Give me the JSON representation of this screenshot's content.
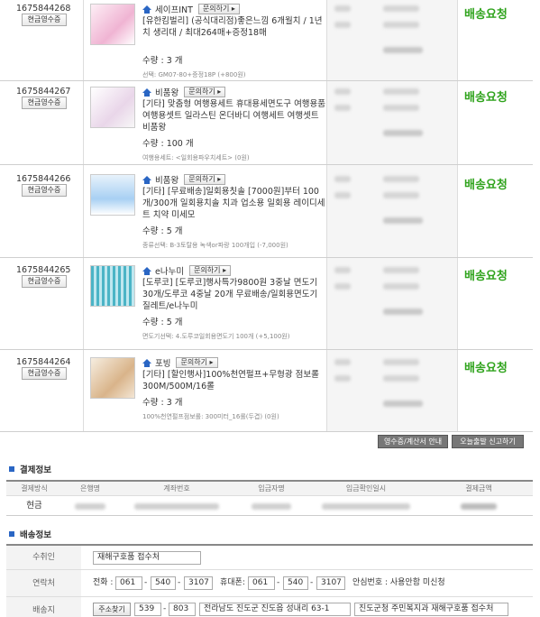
{
  "orders": [
    {
      "id": "1675844268",
      "receipt_label": "현금영수증",
      "seller": "세이프INT",
      "ask_label": "문의하기",
      "title": "[유한킴벌리] (공식대리점)좋은느낌 6개월치 / 1년치 생리대 / 최대264매+증정18매",
      "qty": "수량 : 3 개",
      "option": "선택: GM07-80+증정18P (+800원)",
      "status": "배송요청"
    },
    {
      "id": "1675844267",
      "receipt_label": "현금영수증",
      "seller": "비품왕",
      "ask_label": "문의하기",
      "title": "[기타] 맞춤형 여행용세트 휴대용세면도구 여행용품 여행용셋트 일라스틴 온더바디 여행세트 여행셋트 비품왕",
      "qty": "수량 : 100 개",
      "option": "여행용세트: <일회용파우치세트> (0원)",
      "status": "배송요청"
    },
    {
      "id": "1675844266",
      "receipt_label": "현금영수증",
      "seller": "비품왕",
      "ask_label": "문의하기",
      "title": "[기타] [무료배송]일회용칫솔 [7000원]부터 100개/300개 일회용치솔 치과 업소용 일회용 레이디세트 치약 미세모",
      "qty": "수량 : 5 개",
      "option": "종류선택: B-3토탈용 녹색or파랑 100개입 (-7,000원)",
      "status": "배송요청"
    },
    {
      "id": "1675844265",
      "receipt_label": "현금영수증",
      "seller": "e나누미",
      "ask_label": "문의하기",
      "title": "[도루코] [도루코]행사특가9800원 3중날 면도기30개/도루코 4중날 20개 무료배송/일회용면도기 질레트/e나누미",
      "qty": "수량 : 5 개",
      "option": "면도기선택: 4.도루코일회용면도기 100개 (+5,100원)",
      "status": "배송요청"
    },
    {
      "id": "1675844264",
      "receipt_label": "현금영수증",
      "seller": "포빙",
      "ask_label": "문의하기",
      "title": "[기타] [할인행사]100%천연펄프+무형광 점보롤 300M/500M/16롤",
      "qty": "수량 : 3 개",
      "option": "100%천연펄프점보롤: 300미터_16롤(두겹) (0원)",
      "status": "배송요청"
    }
  ],
  "actions": {
    "receipt_guide": "영수증/계산서 안내",
    "report_error": "오늘출발 신고하기"
  },
  "payment": {
    "title": "결제정보",
    "headers": [
      "결제방식",
      "은행명",
      "계좌번호",
      "입금자명",
      "입금확인일시",
      "결제금액"
    ],
    "method": "현금"
  },
  "shipping": {
    "title": "배송정보",
    "recipient_label": "수취인",
    "recipient": "재해구호품 접수처",
    "contact_label": "연락처",
    "phone_label": "전화 :",
    "phone": [
      "061",
      "540",
      "3107"
    ],
    "mobile_label": "휴대폰:",
    "mobile": [
      "061",
      "540",
      "3107"
    ],
    "safe_number": "안심번호 : 사용안함 미신청",
    "address_label": "배송지",
    "zip_button": "주소찾기",
    "zip": [
      "539",
      "803"
    ],
    "address1": "전라남도 진도군 진도읍 성내리 63-1",
    "address2": "진도군청 주민복지과 재해구호품 접수처"
  }
}
